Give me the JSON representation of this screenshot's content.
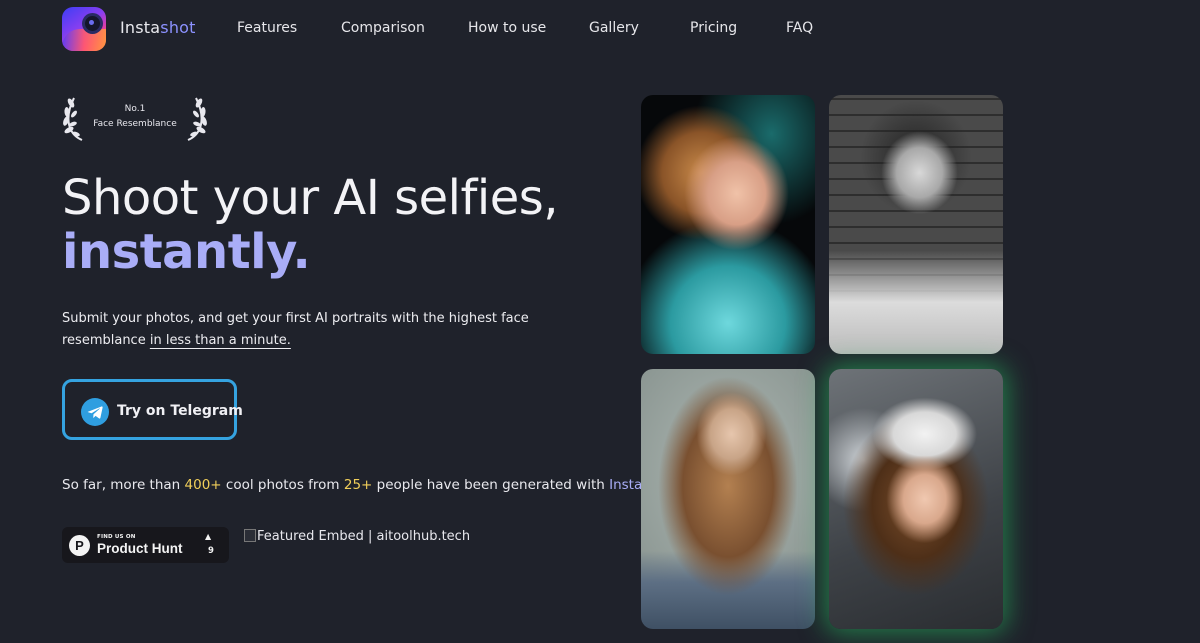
{
  "brand": {
    "name_part1": "Insta",
    "name_part2": "shot"
  },
  "nav": {
    "links": [
      "Features",
      "Comparison",
      "How to use",
      "Gallery",
      "Pricing",
      "FAQ"
    ]
  },
  "award": {
    "line1": "No.1",
    "line2": "Face Resemblance"
  },
  "hero": {
    "title_line1": "Shoot your AI selfies,",
    "title_line2": "instantly.",
    "subtitle_part1": "Submit your photos, and get your first AI portraits with the highest face resemblance ",
    "subtitle_link": "in less than a minute."
  },
  "cta": {
    "label": "Try on Telegram"
  },
  "stats": {
    "prefix": "So far, more than ",
    "photos": "400+",
    "middle": " cool photos from ",
    "people": "25+",
    "suffix": " people have been generated with ",
    "brand": "Instashot"
  },
  "producthunt": {
    "small": "FIND US ON",
    "big": "Product Hunt",
    "arrow": "▲",
    "count": "9",
    "letter": "P"
  },
  "embed": {
    "alt": "Featured Embed | aitoolhub.tech"
  },
  "gallery": {
    "items": [
      "portrait-color-vintage",
      "portrait-bw-brick",
      "portrait-braids",
      "portrait-beret"
    ]
  },
  "colors": {
    "accent": "#a9adf7",
    "highlight": "#f1cf5a",
    "telegram": "#35a3e0",
    "background": "#1f222b"
  }
}
